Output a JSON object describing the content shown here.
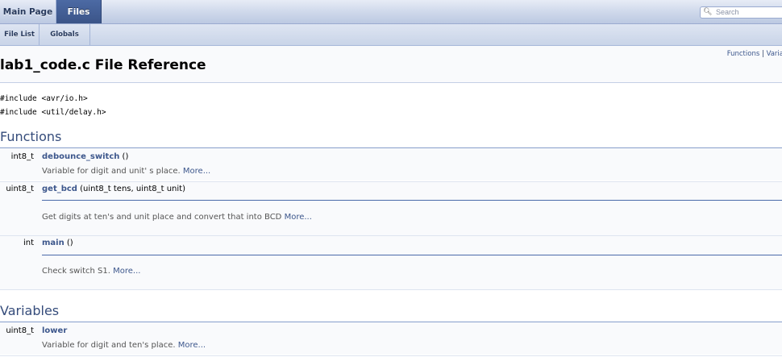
{
  "nav": {
    "main_page": "Main Page",
    "files": "Files",
    "search_placeholder": "Search",
    "file_list": "File List",
    "globals": "Globals"
  },
  "header": {
    "title": "lab1_code.c File Reference",
    "summary_functions": "Functions",
    "summary_sep": " | ",
    "summary_variables": "Varia"
  },
  "includes": [
    "#include <avr/io.h>",
    "#include <util/delay.h>"
  ],
  "sections": {
    "functions_title": "Functions",
    "variables_title": "Variables"
  },
  "functions": [
    {
      "type": "int8_t",
      "name": "debounce_switch",
      "args": " ()",
      "desc": "Variable for digit and unit' s place.",
      "more": "More..."
    },
    {
      "type": "uint8_t",
      "name": "get_bcd",
      "args": " (uint8_t tens, uint8_t unit)",
      "desc": "Get digits at ten's and unit place and convert that into BCD",
      "more": "More..."
    },
    {
      "type": "int",
      "name": "main",
      "args": " ()",
      "desc": "Check switch S1.",
      "more": "More..."
    }
  ],
  "variables": [
    {
      "type": "uint8_t",
      "name": "lower",
      "desc": "Variable for digit and ten's place.",
      "more": "More..."
    }
  ],
  "colors": {
    "link": "#3d578c",
    "heading": "#354c7b",
    "tab_active": "#3b5488"
  }
}
